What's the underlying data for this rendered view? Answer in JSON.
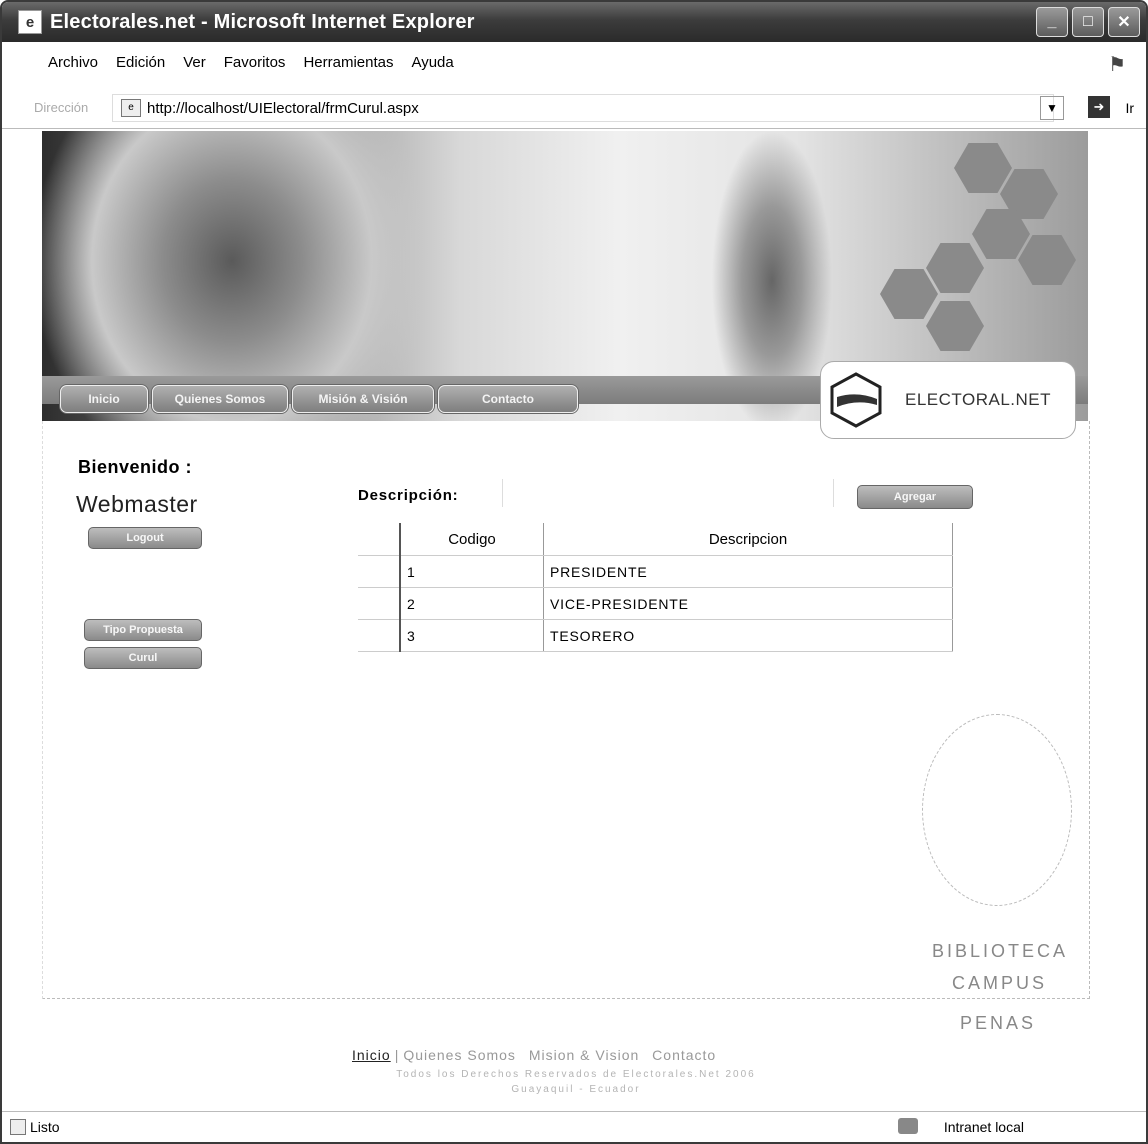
{
  "window": {
    "title": "Electorales.net - Microsoft Internet Explorer",
    "app_icon_glyph": "e"
  },
  "menu": [
    "Archivo",
    "Edición",
    "Ver",
    "Favoritos",
    "Herramientas",
    "Ayuda"
  ],
  "address": {
    "label": "Dirección",
    "url": "http://localhost/UIElectoral/frmCurul.aspx",
    "go_label": "Ir"
  },
  "site_nav": [
    "Inicio",
    "Quienes Somos",
    "Misión & Visión",
    "Contacto"
  ],
  "logo_text": "ELECTORAL.NET",
  "welcome_label": "Bienvenido :",
  "username": "Webmaster",
  "side_buttons": {
    "logout": "Logout",
    "tipo_propuesta": "Tipo Propuesta",
    "curul": "Curul"
  },
  "form": {
    "description_label": "Descripción:",
    "description_value": "",
    "add_button": "Agregar"
  },
  "table": {
    "headers": [
      "Codigo",
      "Descripcion"
    ],
    "rows": [
      {
        "codigo": "1",
        "descripcion": "PRESIDENTE"
      },
      {
        "codigo": "2",
        "descripcion": "VICE-PRESIDENTE"
      },
      {
        "codigo": "3",
        "descripcion": "TESORERO"
      }
    ]
  },
  "stamp": [
    "BIBLIOTECA",
    "CAMPUS",
    "PENAS"
  ],
  "footer": {
    "links": [
      "Inicio",
      "Quienes Somos",
      "Mision & Vision",
      "Contacto"
    ],
    "copyright": "Todos los Derechos Reservados de Electorales.Net 2006",
    "city": "Guayaquil - Ecuador"
  },
  "status": {
    "left": "Listo",
    "zone": "Intranet local"
  }
}
